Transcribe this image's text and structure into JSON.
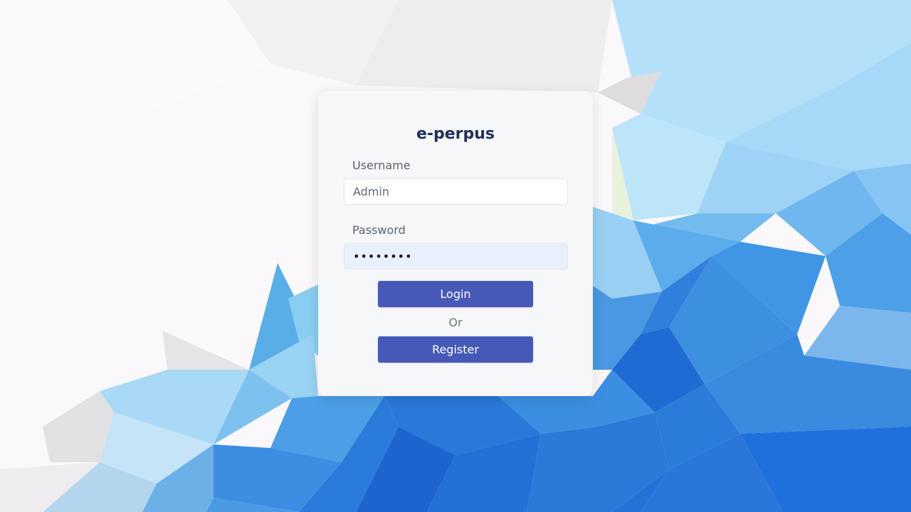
{
  "app": {
    "title": "e-perpus"
  },
  "login_form": {
    "username_label": "Username",
    "username_value": "Admin",
    "password_label": "Password",
    "password_value": "passw0rd",
    "login_label": "Login",
    "separator": "Or",
    "register_label": "Register"
  },
  "colors": {
    "primary_button": "#4759b8",
    "title": "#1f3158",
    "autofill_field": "#e8f0fd",
    "card_background": "#f6f7f9"
  }
}
